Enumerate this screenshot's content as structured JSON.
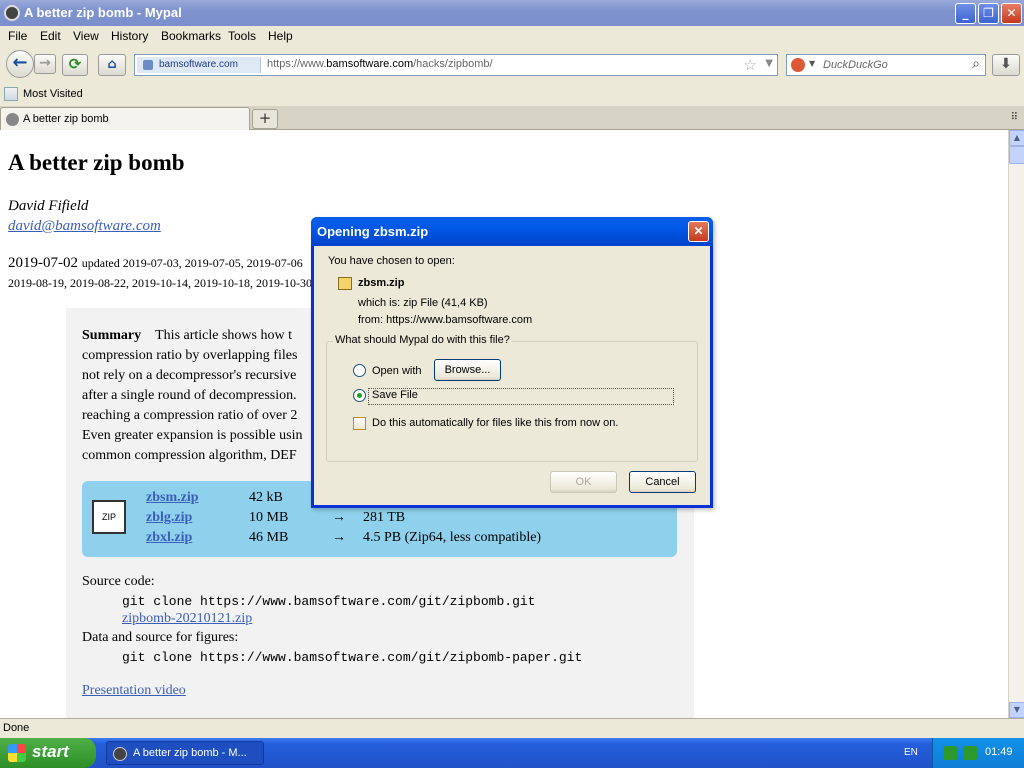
{
  "window": {
    "title": "A better zip bomb - Mypal",
    "minimize_glyph": "_",
    "maximize_glyph": "❐",
    "close_glyph": "✕"
  },
  "menu": [
    "File",
    "Edit",
    "View",
    "History",
    "Bookmarks",
    "Tools",
    "Help"
  ],
  "nav": {
    "back_glyph": "←",
    "forward_glyph": "→",
    "reload_glyph": "⟳",
    "home_glyph": "⌂",
    "site_identity": "bamsoftware.com",
    "url_prefix": "https://www.",
    "url_domain": "bamsoftware.com",
    "url_path": "/hacks/zipbomb/",
    "bookmark_star": "☆",
    "url_dropdown": "▼",
    "search_placeholder": "DuckDuckGo",
    "search_glyph": "⌕",
    "download_glyph": "⬇"
  },
  "bookmarks": {
    "most_visited": "Most Visited"
  },
  "tabs": [
    {
      "label": "A better zip bomb"
    }
  ],
  "new_tab_glyph": "+",
  "tab_list_glyph": "⠿",
  "page": {
    "title": "A better zip bomb",
    "author": "David Fifield",
    "email": "david@bamsoftware.com",
    "date_main": "2019-07-02",
    "date_updated": "updated 2019-07-03, 2019-07-05, 2019-07-06",
    "date_line2": "2019-08-19, 2019-08-22, 2019-10-14, 2019-10-18, 2019-10-30",
    "summary_heading": "Summary",
    "summary_lines": [
      "This article shows how t",
      "compression ratio by overlapping files",
      "not rely on a decompressor's recursive",
      "after a single round of decompression.",
      "reaching a compression ratio of over 2",
      "Even greater expansion is possible usin",
      "common compression algorithm, DEF"
    ],
    "zip_icon_label": "ZIP",
    "files": [
      {
        "name": "zbsm.zip",
        "size": "42 kB",
        "arrow": "",
        "expanded": ""
      },
      {
        "name": "zblg.zip",
        "size": "10 MB",
        "arrow": "→",
        "expanded": "281 TB"
      },
      {
        "name": "zbxl.zip",
        "size": "46 MB",
        "arrow": "→",
        "expanded": "4.5 PB (Zip64, less compatible)"
      }
    ],
    "source_label": "Source code:",
    "source_cmd": "git clone https://www.bamsoftware.com/git/zipbomb.git",
    "source_zip": "zipbomb-20210121.zip",
    "data_label": "Data and source for figures:",
    "data_cmd": "git clone https://www.bamsoftware.com/git/zipbomb-paper.git",
    "video_link": "Presentation video"
  },
  "status": "Done",
  "taskbar": {
    "start": "start",
    "task_label": "A better zip bomb - M...",
    "lang": "EN",
    "clock": "01:49"
  },
  "dialog": {
    "title": "Opening zbsm.zip",
    "close_glyph": "✕",
    "chosen": "You have chosen to open:",
    "file_name": "zbsm.zip",
    "which_is": "which is:  zip File (41,4 KB)",
    "from": "from:  https://www.bamsoftware.com",
    "question": "What should Mypal do with this file?",
    "open_with": "Open with",
    "browse": "Browse...",
    "save_file": "Save File",
    "auto": "Do this automatically for files like this from now on.",
    "ok": "OK",
    "cancel": "Cancel",
    "selected_option": "save_file"
  }
}
